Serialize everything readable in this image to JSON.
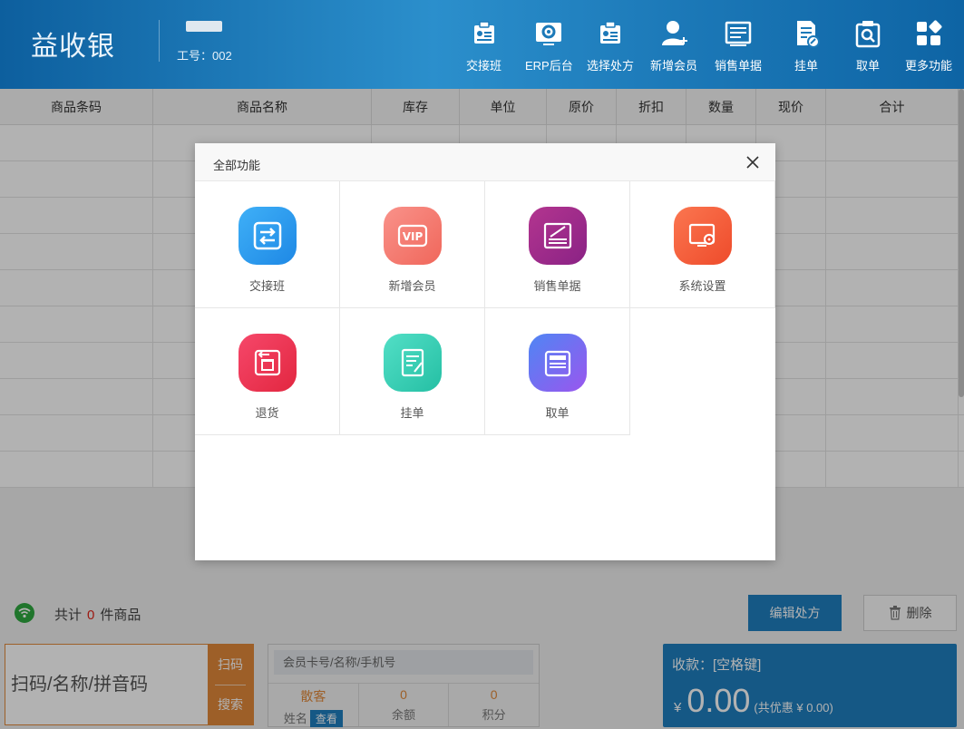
{
  "header": {
    "brand": "益收银",
    "job_no": "工号：002",
    "tools": [
      {
        "label": "交接班",
        "icon": "shift-handover-icon"
      },
      {
        "label": "ERP后台",
        "icon": "erp-settings-icon"
      },
      {
        "label": "选择处方",
        "icon": "prescription-icon"
      },
      {
        "label": "新增会员",
        "icon": "add-member-icon"
      },
      {
        "label": "销售单据",
        "icon": "sales-receipt-icon"
      },
      {
        "label": "挂单",
        "icon": "hold-order-icon"
      },
      {
        "label": "取单",
        "icon": "retrieve-order-icon"
      },
      {
        "label": "更多功能",
        "icon": "more-functions-icon"
      }
    ]
  },
  "table": {
    "columns": [
      "商品条码",
      "商品名称",
      "库存",
      "单位",
      "原价",
      "折扣",
      "数量",
      "现价",
      "合计"
    ]
  },
  "status": {
    "total_prefix": "共计",
    "total_count": "0",
    "total_suffix": "件商品",
    "edit_button": "编辑处方",
    "delete_button": "删除"
  },
  "scan": {
    "placeholder": "扫码/名称/拼音码",
    "scan_button": "扫码",
    "search_button": "搜索"
  },
  "member": {
    "placeholder": "会员卡号/名称/手机号",
    "name_value": "散客",
    "name_label": "姓名",
    "view_button": "查看",
    "balance_value": "0",
    "balance_label": "余额",
    "points_value": "0",
    "points_label": "积分"
  },
  "payment": {
    "label": "收款：[空格键]",
    "currency": "¥",
    "amount": "0.00",
    "discount": "(共优惠 ¥  0.00)"
  },
  "modal": {
    "title": "全部功能",
    "items": [
      {
        "label": "交接班",
        "icon": "shift-handover-icon",
        "color": "#2a9bf0"
      },
      {
        "label": "新增会员",
        "icon": "vip-icon",
        "color": "#f47a6c"
      },
      {
        "label": "销售单据",
        "icon": "sales-receipt-icon",
        "color": "#9b2a8f"
      },
      {
        "label": "系统设置",
        "icon": "system-settings-icon",
        "color": "#f35c3a"
      },
      {
        "label": "退货",
        "icon": "return-goods-icon",
        "color": "#ee3552"
      },
      {
        "label": "挂单",
        "icon": "hold-order-icon",
        "color": "#3fcfb6"
      },
      {
        "label": "取单",
        "icon": "retrieve-order-icon",
        "color": "#6f6bf0"
      }
    ]
  }
}
